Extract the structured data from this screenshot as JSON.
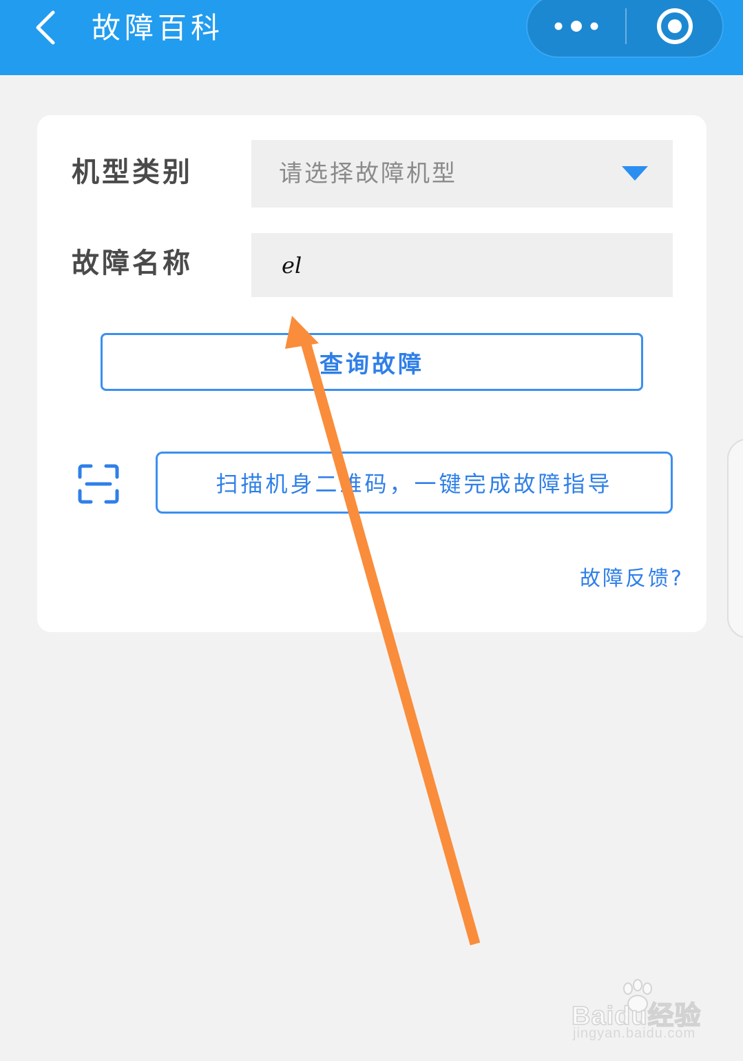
{
  "header": {
    "title": "故障百科",
    "back_icon": "chevron-left-icon",
    "more_icon": "more-dots-icon",
    "close_icon": "target-close-icon",
    "bg_color": "#219cef"
  },
  "form": {
    "model_label": "机型类别",
    "model_placeholder": "请选择故障机型",
    "fault_label": "故障名称",
    "fault_value": "el",
    "query_button": "查询故障",
    "scan_icon": "scan-icon",
    "scan_button": "扫描机身二维码，一键完成故障指导",
    "feedback_link": "故障反馈?",
    "accent_color": "#2f7fe8"
  },
  "annotation": {
    "arrow_color": "#f98d3b"
  },
  "watermark": {
    "brand": "Baidu经验",
    "url": "jingyan.baidu.com"
  }
}
